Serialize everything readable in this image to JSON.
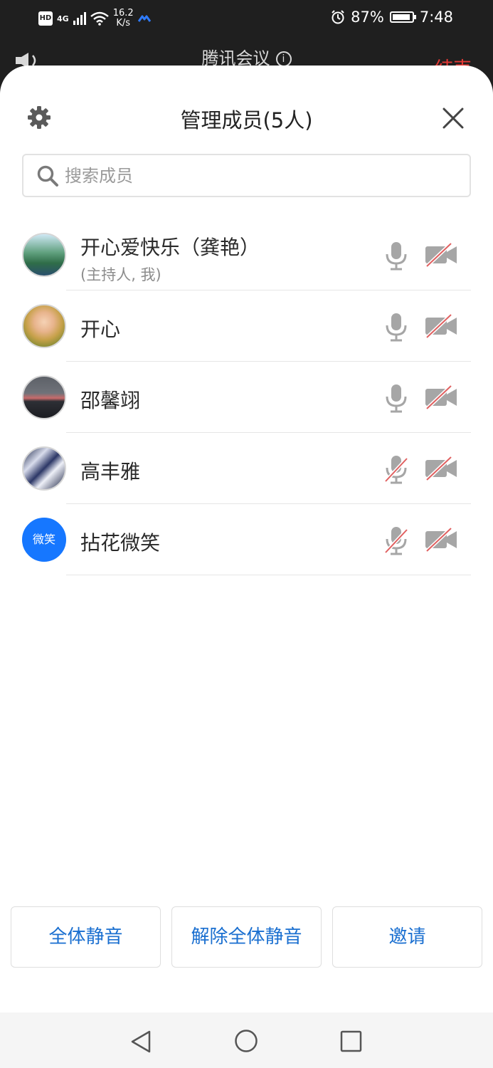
{
  "status_bar": {
    "hd": "HD",
    "network": "4G",
    "net_speed_value": "16.2",
    "net_speed_unit": "K/s",
    "battery": "87%",
    "time": "7:48"
  },
  "meeting": {
    "title": "腾讯会议",
    "info": "i",
    "end_label": "结束"
  },
  "sheet": {
    "title": "管理成员(5人)",
    "search_placeholder": "搜索成员"
  },
  "members": [
    {
      "name": "开心爱快乐（龚艳）",
      "sub": "(主持人, 我)",
      "avatar": "landscape-avatar",
      "mic": "on",
      "camera": "off"
    },
    {
      "name": "开心",
      "avatar": "child-photo-avatar",
      "mic": "on",
      "camera": "off"
    },
    {
      "name": "邵馨翊",
      "avatar": "sunset-sea-avatar",
      "mic": "on",
      "camera": "off"
    },
    {
      "name": "高丰雅",
      "avatar": "snow-mountain-avatar",
      "mic": "off",
      "camera": "off"
    },
    {
      "name": "拈花微笑",
      "avatar_text": "微笑",
      "avatar_color": "#1677ff",
      "mic": "off",
      "camera": "off"
    }
  ],
  "actions": {
    "mute_all": "全体静音",
    "unmute_all": "解除全体静音",
    "invite": "邀请"
  },
  "colors": {
    "accent": "#1a6fd0",
    "end_red": "#e53935",
    "slash_red": "#e06060",
    "icon_gray": "#a6a6a6"
  }
}
